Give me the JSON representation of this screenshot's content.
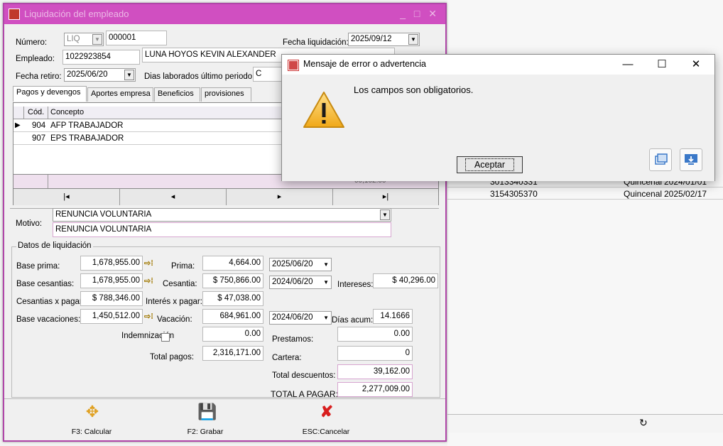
{
  "background": {
    "rows": [
      {
        "phone": "3013340331",
        "freq": "Quincenal",
        "date": "2024/01/01"
      },
      {
        "phone": "3154305370",
        "freq": "Quincenal",
        "date": "2025/02/17"
      }
    ],
    "footer_icon": "refresh-icon"
  },
  "window": {
    "title": "Liquidación del empleado",
    "numero_label": "Número:",
    "numero_type": "LIQ",
    "numero_value": "000001",
    "fecha_liq_label": "Fecha liquidación:",
    "fecha_liq_value": "2025/09/12",
    "empleado_label": "Empleado:",
    "empleado_id": "1022923854",
    "empleado_name": "LUNA HOYOS KEVIN ALEXANDER",
    "fecha_retiro_label": "Fecha retiro:",
    "fecha_retiro_value": "2025/06/20",
    "dias_label": "Dias laborados último periodo:",
    "dias_value_partial": "C"
  },
  "tabs": [
    {
      "label": "Pagos y devengos",
      "active": true
    },
    {
      "label": "Aportes empresa",
      "active": false
    },
    {
      "label": "Beneficios",
      "active": false
    },
    {
      "label": "provisiones",
      "active": false
    }
  ],
  "grid": {
    "headers": {
      "cod": "Cód.",
      "concepto": "Concepto"
    },
    "rows": [
      {
        "cod": "904",
        "concepto": "AFP TRABAJADOR"
      },
      {
        "cod": "907",
        "concepto": "EPS TRABAJADOR"
      }
    ],
    "footer_partial": "00,102.00",
    "nav": [
      "|◂",
      "◂",
      "▸",
      "▸|"
    ]
  },
  "motivo": {
    "label": "Motivo:",
    "select_value": "RENUNCIA VOLUNTARIA",
    "text_value": "RENUNCIA VOLUNTARIA"
  },
  "datos": {
    "legend": "Datos de liquidación",
    "base_prima_label": "Base prima:",
    "base_prima": "1,678,955.00",
    "base_cesantias_label": "Base cesantias:",
    "base_cesantias": "1,678,955.00",
    "cesantias_pagar_label": "Cesantias x pagar",
    "cesantias_pagar": "$ 788,346.00",
    "base_vacaciones_label": "Base vacaciones:",
    "base_vacaciones": "1,450,512.00",
    "prima_label": "Prima:",
    "prima": "4,664.00",
    "cesantia_label": "Cesantia:",
    "cesantia": "$ 750,866.00",
    "interes_pagar_label": "Interés x pagar:",
    "interes_pagar": "$ 47,038.00",
    "vacacion_label": "Vacación:",
    "vacacion": "684,961.00",
    "fecha_prima": "2025/06/20",
    "fecha_cesantia": "2024/06/20",
    "fecha_vacacion": "2024/06/20",
    "intereses_label": "Intereses:",
    "intereses": "$ 40,296.00",
    "dias_acum_label": "Días acum:",
    "dias_acum": "14.1666",
    "indemnizacion_label": "Indemnización",
    "indemnizacion": "0.00",
    "total_pagos_label": "Total pagos:",
    "total_pagos": "2,316,171.00",
    "prestamos_label": "Prestamos:",
    "prestamos": "0.00",
    "cartera_label": "Cartera:",
    "cartera": "0",
    "total_descuentos_label": "Total descuentos:",
    "total_descuentos": "39,162.00",
    "total_pagar_label": "TOTAL A PAGAR:",
    "total_pagar": "2,277,009.00"
  },
  "toolbar": {
    "calcular": "F3: Calcular",
    "grabar": "F2: Grabar",
    "cancelar": "ESC:Cancelar"
  },
  "dialog": {
    "title": "Mensaje de error o advertencia",
    "message": "Los campos  son obligatorios.",
    "ok_label": "Aceptar",
    "min": "—",
    "max": "☐",
    "close": "✕"
  },
  "colors": {
    "title_bar": "#d04fc1",
    "border": "#b046a8",
    "warning": "#f5c542"
  }
}
